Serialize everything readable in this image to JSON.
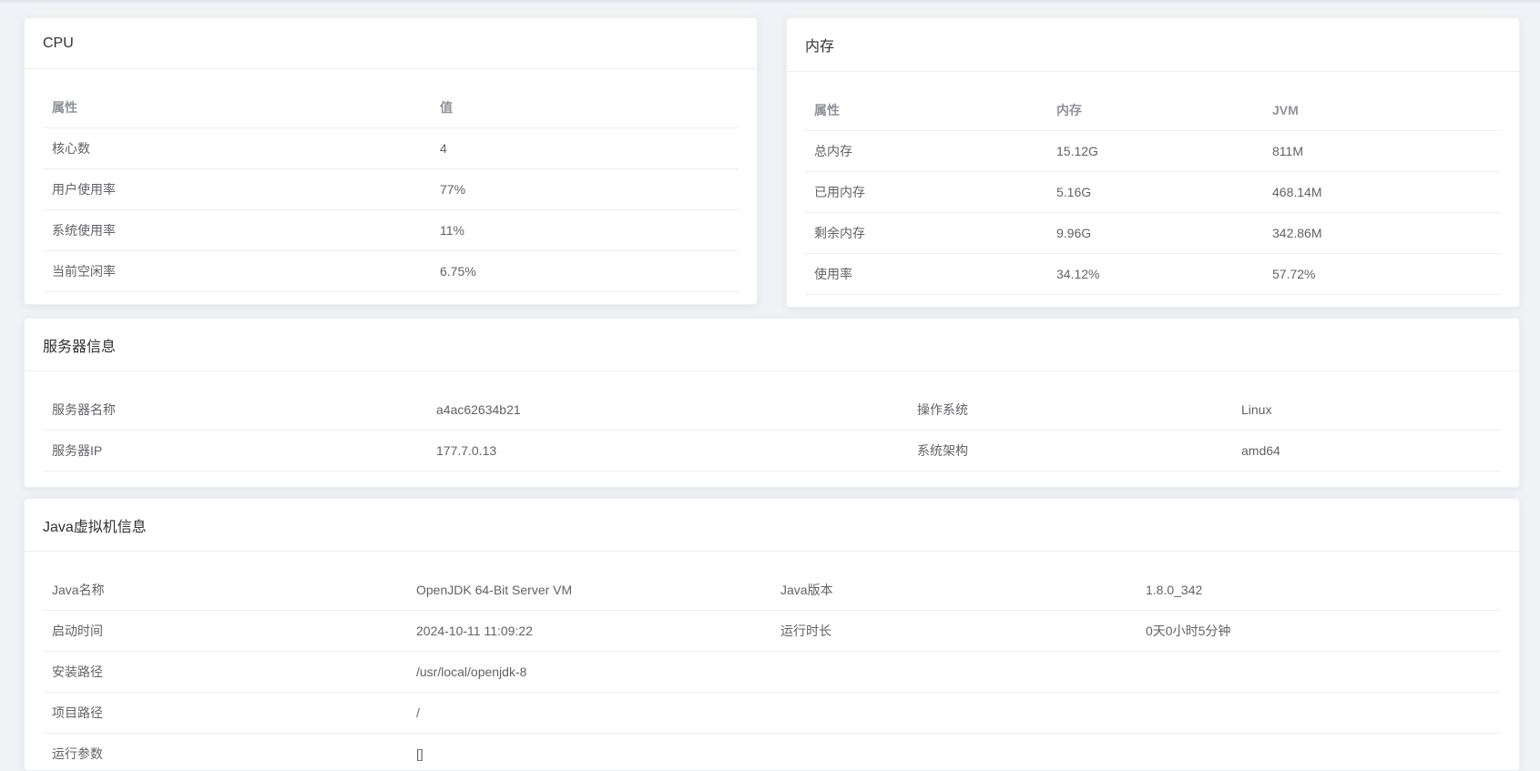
{
  "cpu": {
    "title": "CPU",
    "headers": [
      "属性",
      "值"
    ],
    "rows": [
      [
        "核心数",
        "4"
      ],
      [
        "用户使用率",
        "77%"
      ],
      [
        "系统使用率",
        "11%"
      ],
      [
        "当前空闲率",
        "6.75%"
      ]
    ]
  },
  "mem": {
    "title": "内存",
    "headers": [
      "属性",
      "内存",
      "JVM"
    ],
    "rows": [
      [
        "总内存",
        "15.12G",
        "811M"
      ],
      [
        "已用内存",
        "5.16G",
        "468.14M"
      ],
      [
        "剩余内存",
        "9.96G",
        "342.86M"
      ],
      [
        "使用率",
        "34.12%",
        "57.72%"
      ]
    ]
  },
  "sys": {
    "title": "服务器信息",
    "rows": [
      [
        "服务器名称",
        "a4ac62634b21",
        "操作系统",
        "Linux"
      ],
      [
        "服务器IP",
        "177.7.0.13",
        "系统架构",
        "amd64"
      ]
    ]
  },
  "jvm": {
    "title": "Java虚拟机信息",
    "rows": [
      [
        "Java名称",
        "OpenJDK 64-Bit Server VM",
        "Java版本",
        "1.8.0_342"
      ],
      [
        "启动时间",
        "2024-10-11 11:09:22",
        "运行时长",
        "0天0小时5分钟"
      ],
      [
        "安装路径",
        "/usr/local/openjdk-8",
        "",
        ""
      ],
      [
        "项目路径",
        "/",
        "",
        ""
      ],
      [
        "运行参数",
        "[]",
        "",
        ""
      ]
    ]
  }
}
